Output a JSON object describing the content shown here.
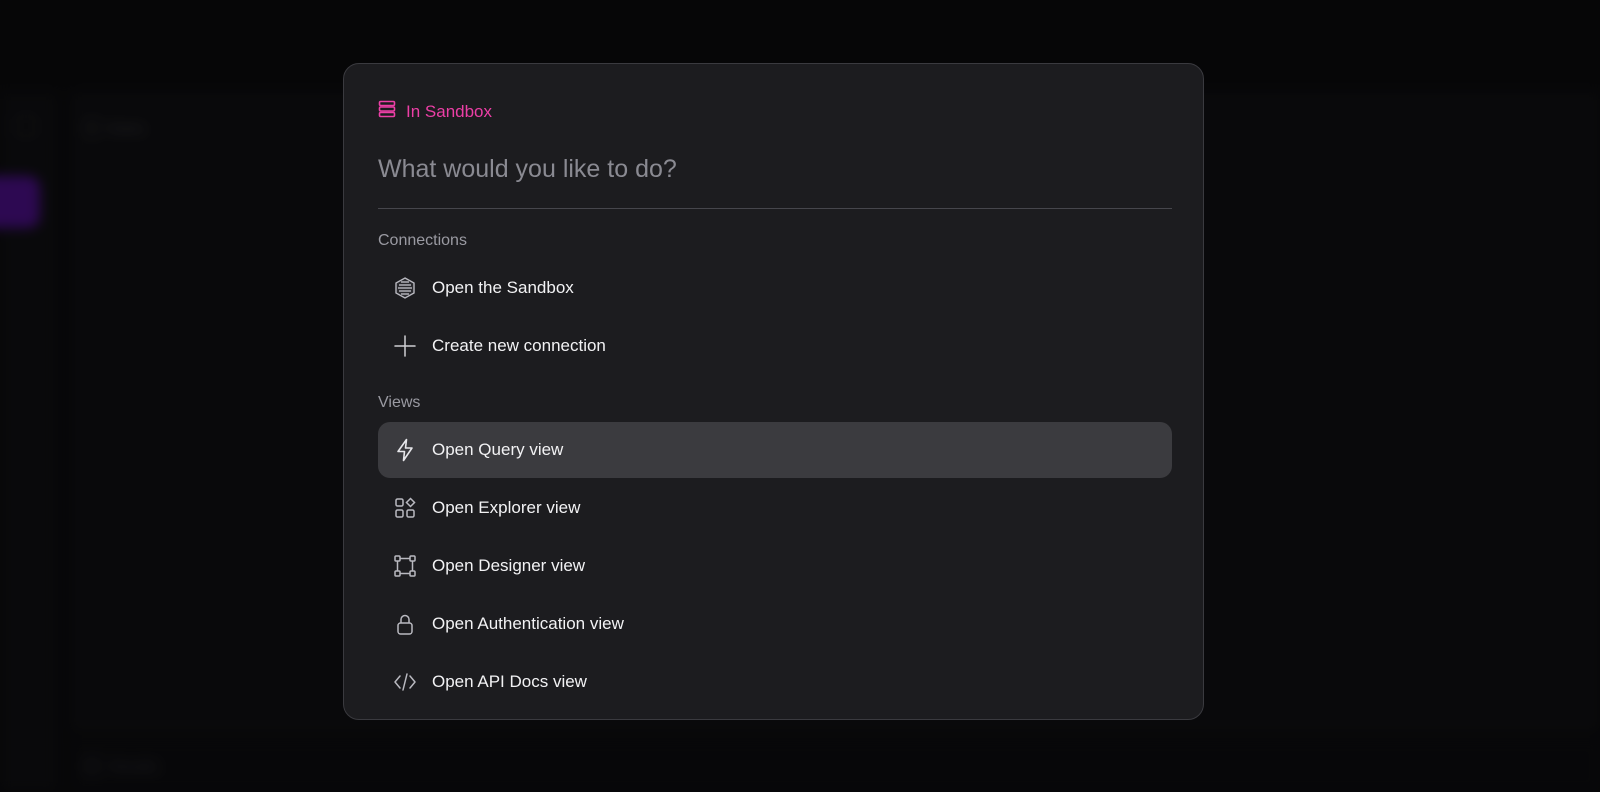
{
  "background": {
    "tab_label": "Notes",
    "bottom_label": "Results"
  },
  "palette": {
    "context_accent": "#ec3fa6",
    "active_item_bg": "#3b3b3f",
    "dialog_bg": "#1c1c1f"
  },
  "command_palette": {
    "context_label": "In Sandbox",
    "context_icon": "stack-icon",
    "search": {
      "placeholder": "What would you like to do?",
      "value": ""
    },
    "sections": {
      "connections": {
        "label": "Connections",
        "items": [
          {
            "label": "Open the Sandbox",
            "icon": "hexagon-icon"
          },
          {
            "label": "Create new connection",
            "icon": "plus-icon"
          }
        ]
      },
      "views": {
        "label": "Views",
        "items": [
          {
            "label": "Open Query view",
            "icon": "lightning-icon",
            "active": true
          },
          {
            "label": "Open Explorer view",
            "icon": "grid-shapes-icon"
          },
          {
            "label": "Open Designer view",
            "icon": "vector-nodes-icon"
          },
          {
            "label": "Open Authentication view",
            "icon": "lock-icon"
          },
          {
            "label": "Open API Docs view",
            "icon": "code-icon"
          }
        ]
      }
    }
  }
}
